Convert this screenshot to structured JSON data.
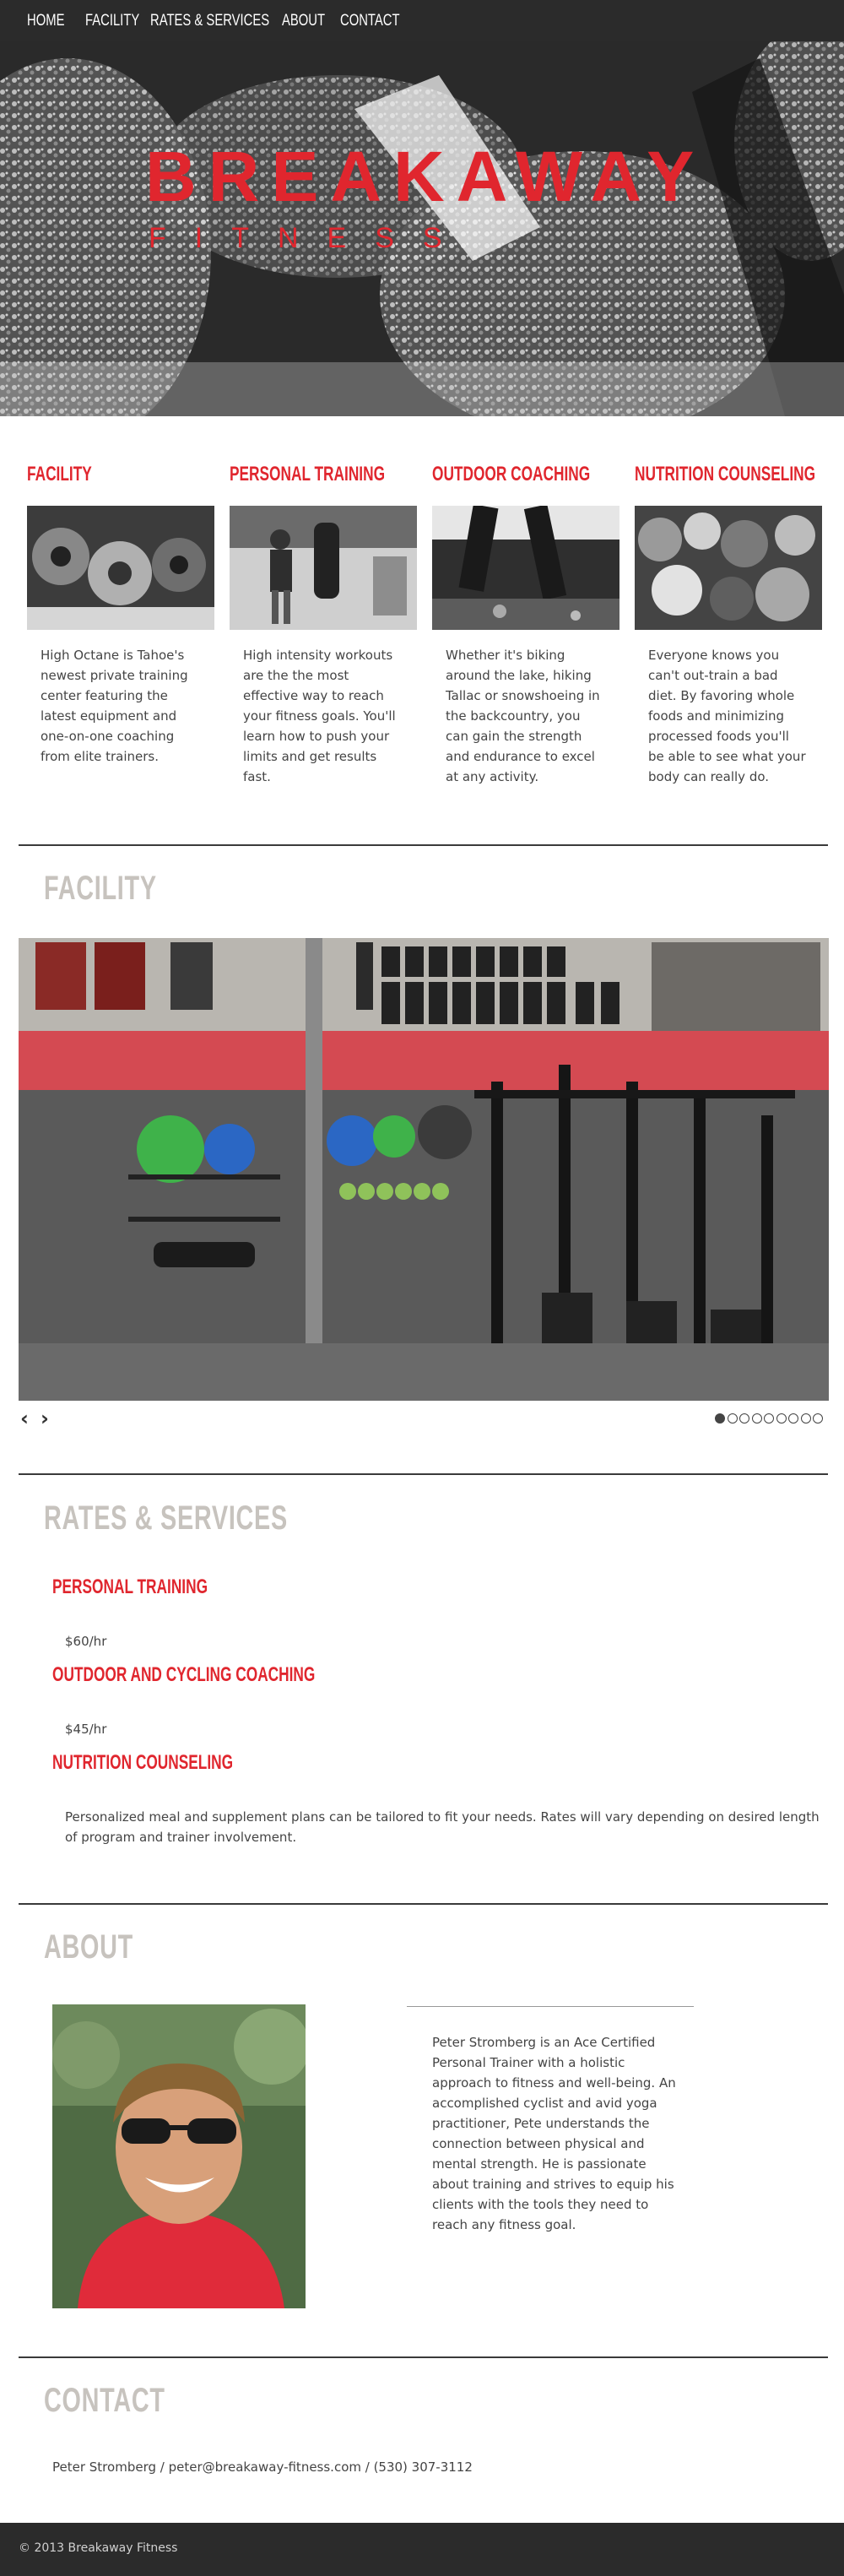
{
  "nav": {
    "items": [
      {
        "label": "HOME"
      },
      {
        "label": "FACILITY"
      },
      {
        "label": "RATES & SERVICES"
      },
      {
        "label": "ABOUT"
      },
      {
        "label": "CONTACT"
      }
    ]
  },
  "hero": {
    "title": "BREAKAWAY",
    "subtitle": "FITNESS"
  },
  "services": [
    {
      "title": "FACILITY",
      "text": "High Octane is Tahoe's newest private training center featuring the latest equipment and one-on-one coaching from elite trainers."
    },
    {
      "title": "PERSONAL TRAINING",
      "text": "High intensity workouts are the the most effective way to reach your fitness goals. You'll learn how to push your limits and get results fast."
    },
    {
      "title": "OUTDOOR COACHING",
      "text": "Whether it's biking around the lake, hiking Tallac or snowshoeing in the backcountry, you can gain the strength and endurance to excel at any activity."
    },
    {
      "title": "NUTRITION COUNSELING",
      "text": "Everyone knows you can't out-train a bad diet. By favoring whole foods and minimizing processed foods you'll be able to see what your body can really do."
    }
  ],
  "facility": {
    "title": "FACILITY",
    "prev_icon": "chevron-left-icon",
    "next_icon": "chevron-right-icon",
    "slide_count": 9,
    "active_slide": 1
  },
  "rates": {
    "title": "RATES & SERVICES",
    "items": [
      {
        "name": "PERSONAL TRAINING",
        "detail": "$60/hr"
      },
      {
        "name": "OUTDOOR AND CYCLING COACHING",
        "detail": "$45/hr"
      },
      {
        "name": "NUTRITION COUNSELING",
        "detail": "Personalized meal and supplement plans can be tailored to fit your needs. Rates will vary depending on desired length of program and trainer involvement."
      }
    ]
  },
  "about": {
    "title": "ABOUT",
    "bio": "Peter Stromberg is an Ace Certified Personal Trainer with a holistic approach to fitness and well-being. An accomplished cyclist and avid yoga practitioner, Pete understands the connection between physical and mental strength. He is passionate about training and strives to equip his clients with the tools they need to reach any fitness goal."
  },
  "contact": {
    "title": "CONTACT",
    "line": "Peter Stromberg / peter@breakaway-fitness.com / (530) 307-3112"
  },
  "footer": {
    "copyright": "© 2013 Breakaway Fitness"
  },
  "colors": {
    "accent": "#e0262e",
    "nav_bg": "#2b2b2b",
    "section_title": "#c7c3be",
    "body_text": "#444444"
  }
}
